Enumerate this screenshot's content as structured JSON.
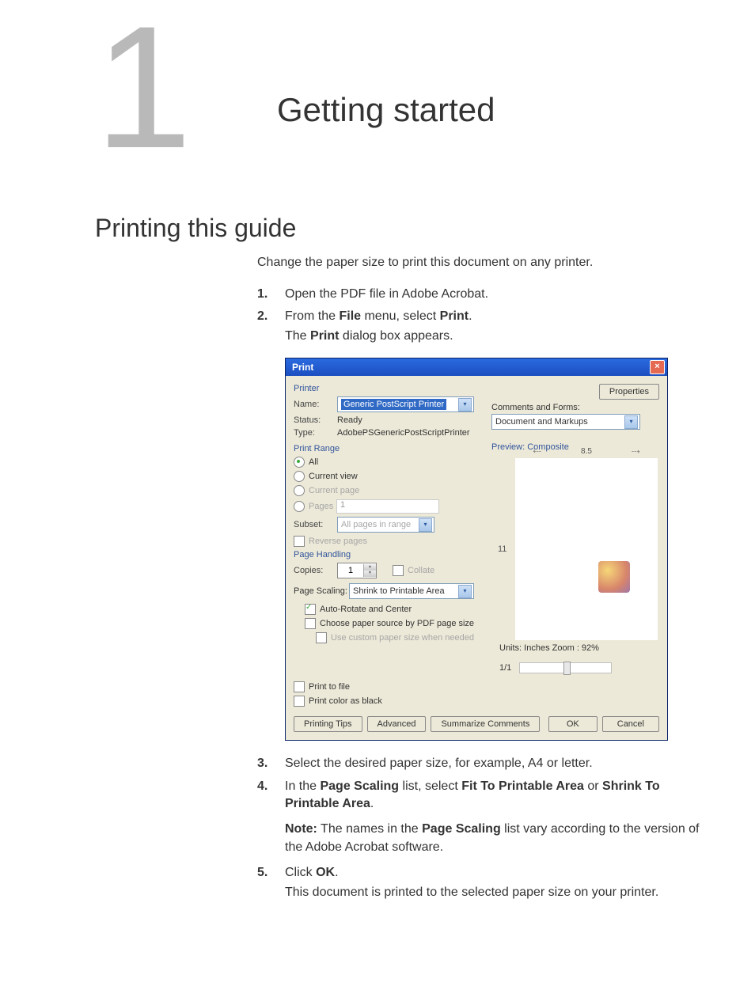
{
  "chapter": {
    "number": "1",
    "title": "Getting started"
  },
  "section": {
    "title": "Printing this guide"
  },
  "intro": "Change the paper size to print this document on any printer.",
  "steps": {
    "s1": "Open the PDF file in Adobe Acrobat.",
    "s2a": "From the ",
    "s2b": "File",
    "s2c": " menu, select ",
    "s2d": "Print",
    "s2e": ".",
    "s2f1": "The ",
    "s2f2": "Print",
    "s2f3": " dialog box appears.",
    "s3": "Select the desired paper size, for example, A4 or letter.",
    "s4a": "In the ",
    "s4b": "Page Scaling",
    "s4c": " list, select ",
    "s4d": "Fit To Printable Area",
    "s4e": " or ",
    "s4f": "Shrink To Printable Area",
    "s4g": ".",
    "note1": "Note:",
    "note2": " The names in the ",
    "note3": "Page Scaling",
    "note4": " list vary according to the version of the Adobe Acrobat software.",
    "s5a": "Click ",
    "s5b": "OK",
    "s5c": ".",
    "s5sub": "This document is printed to the selected paper size on your printer."
  },
  "dialog": {
    "title": "Print",
    "printer_group": "Printer",
    "name_lbl": "Name:",
    "name_val": "Generic PostScript Printer",
    "properties_btn": "Properties",
    "status_lbl": "Status:",
    "status_val": "Ready",
    "type_lbl": "Type:",
    "type_val": "AdobePSGenericPostScriptPrinter",
    "comments_lbl": "Comments and Forms:",
    "comments_val": "Document and Markups",
    "range_group": "Print Range",
    "range_all": "All",
    "range_currentview": "Current view",
    "range_currentpage": "Current page",
    "range_pages": "Pages",
    "range_pages_val": "1",
    "subset_lbl": "Subset:",
    "subset_val": "All pages in range",
    "reverse": "Reverse pages",
    "handling_group": "Page Handling",
    "copies_lbl": "Copies:",
    "copies_val": "1",
    "collate": "Collate",
    "scaling_lbl": "Page Scaling:",
    "scaling_val": "Shrink to Printable Area",
    "autorotate": "Auto-Rotate and Center",
    "papersource": "Choose paper source by PDF page size",
    "custompaper": "Use custom paper size when needed",
    "printtofile": "Print to file",
    "printblack": "Print color as black",
    "preview_group": "Preview: Composite",
    "preview_w": "8.5",
    "preview_h": "11",
    "units": "Units: Inches Zoom :  92%",
    "pagecount": "1/1",
    "tips_btn": "Printing Tips",
    "advanced_btn": "Advanced",
    "summarize_btn": "Summarize Comments",
    "ok_btn": "OK",
    "cancel_btn": "Cancel"
  }
}
